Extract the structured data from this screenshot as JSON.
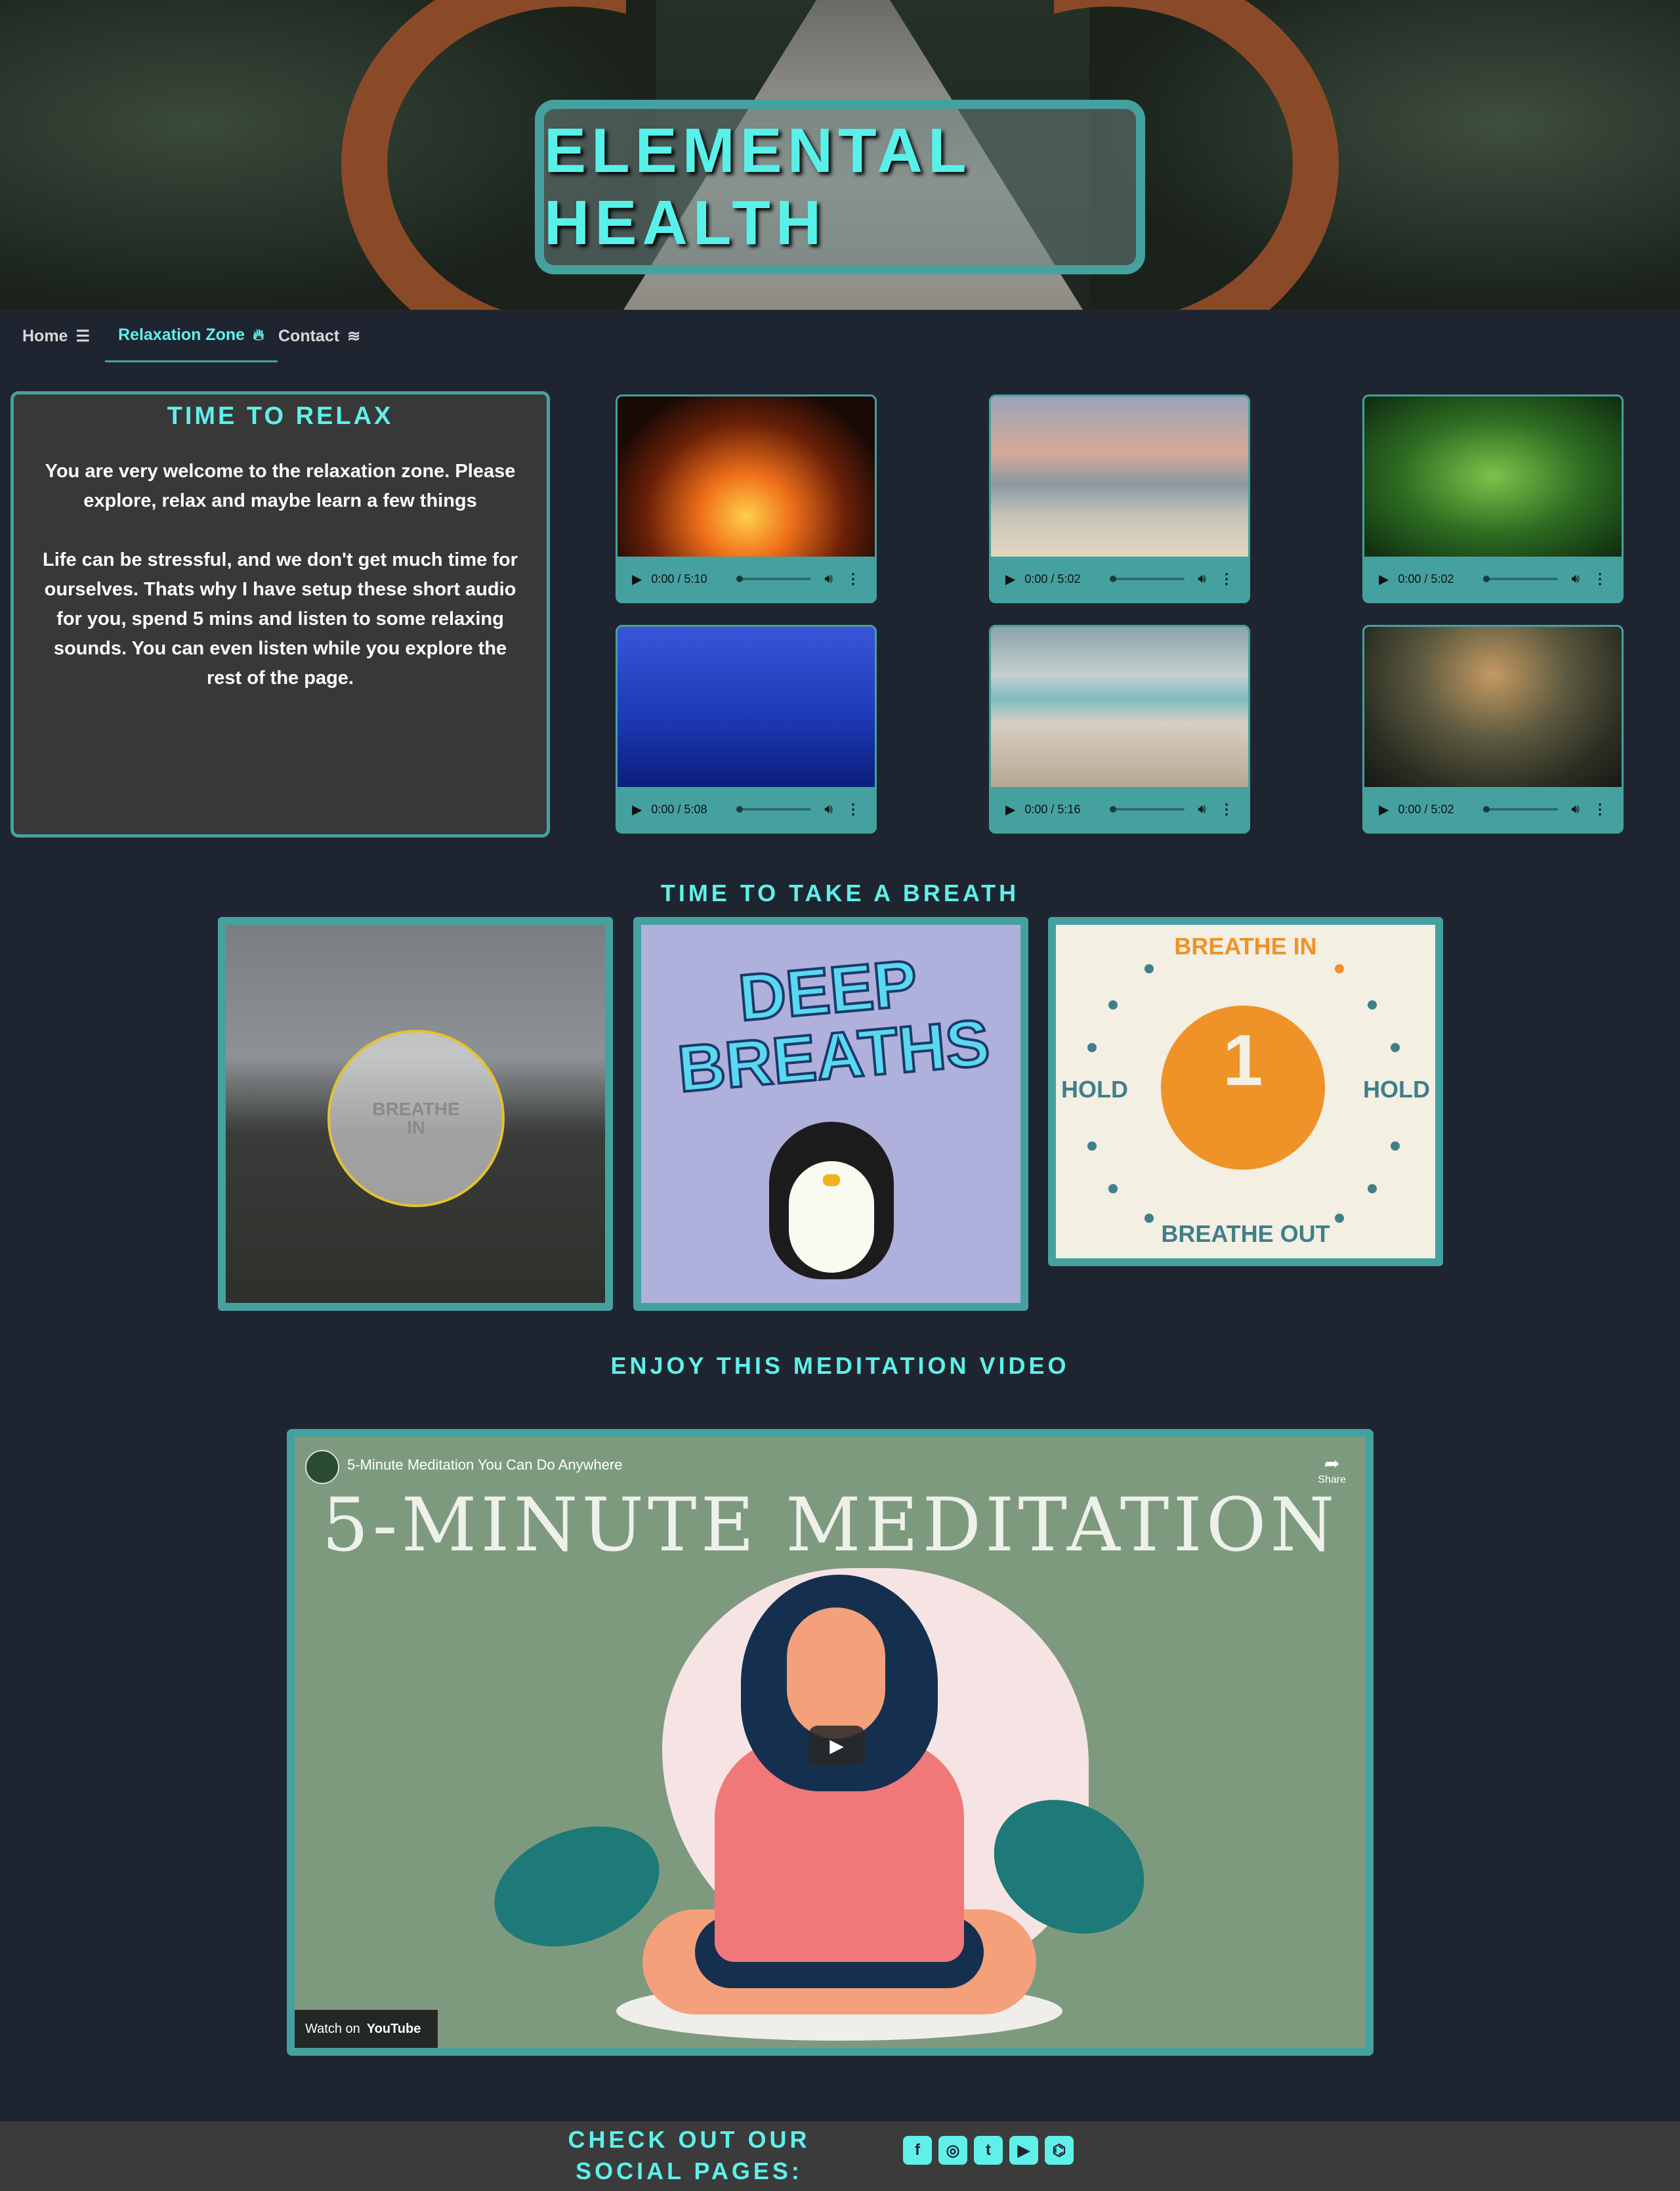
{
  "header": {
    "title": "ELEMENTAL HEALTH"
  },
  "nav": {
    "items": [
      {
        "label": "Home",
        "icon": "sliders-icon"
      },
      {
        "label": "Relaxation Zone",
        "icon": "fire-icon",
        "active": true
      },
      {
        "label": "Contact",
        "icon": "wind-icon"
      }
    ]
  },
  "relax": {
    "title": "TIME TO RELAX",
    "para1": "You are very welcome to the relaxation zone. Please explore, relax and maybe learn a few things",
    "para2": "Life can be stressful, and we don't get much time for ourselves. Thats why I have setup these short audio for you, spend 5 mins and listen to some relaxing sounds. You can even listen while you explore the rest of the page."
  },
  "audio": [
    {
      "scene": "fireplace",
      "time": "0:00 / 5:10"
    },
    {
      "scene": "beach",
      "time": "0:00 / 5:02"
    },
    {
      "scene": "jungle",
      "time": "0:00 / 5:02"
    },
    {
      "scene": "whale",
      "time": "0:00 / 5:08"
    },
    {
      "scene": "kalimba",
      "time": "0:00 / 5:16"
    },
    {
      "scene": "lake",
      "time": "0:00 / 5:02"
    }
  ],
  "breath": {
    "title": "TIME TO TAKE A BREATH",
    "gif1": "BREATHE IN",
    "gif2": "DEEP BREATHS",
    "gif3": {
      "top": "BREATHE IN",
      "left": "HOLD",
      "right": "HOLD",
      "bottom": "BREATHE OUT",
      "count": "1"
    }
  },
  "video": {
    "section_title": "ENJOY THIS MEDITATION VIDEO",
    "title": "5-Minute Meditation You Can Do Anywhere",
    "share": "Share",
    "big_text": "5-MINUTE MEDITATION",
    "watch_on": "Watch on",
    "youtube": "YouTube"
  },
  "footer": {
    "title": "CHECK OUT OUR SOCIAL PAGES:",
    "socials": [
      "facebook-icon",
      "instagram-icon",
      "twitter-icon",
      "youtube-icon",
      "github-icon"
    ]
  },
  "colors": {
    "accent": "#45a1a0",
    "title": "#5ff0ea",
    "bg": "#1f2530"
  }
}
